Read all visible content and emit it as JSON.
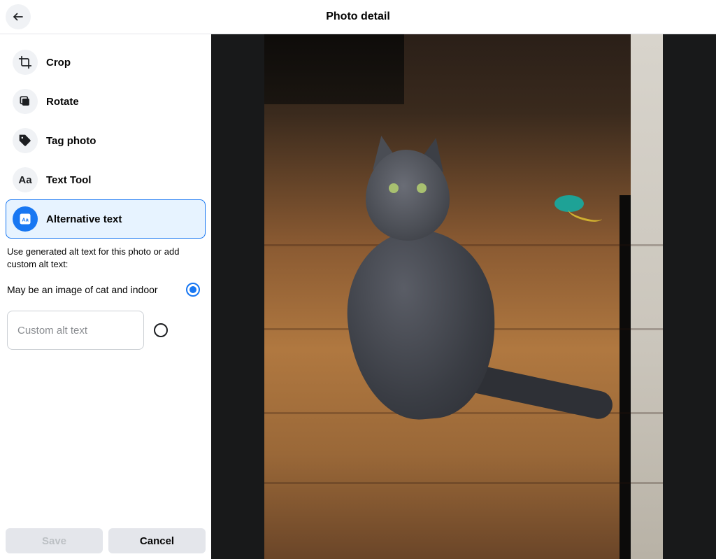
{
  "header": {
    "title": "Photo detail"
  },
  "sidebar": {
    "tools": {
      "crop": "Crop",
      "rotate": "Rotate",
      "tag_photo": "Tag photo",
      "text_tool": "Text Tool",
      "alt_text": "Alternative text"
    },
    "alt": {
      "instructions": "Use generated alt text for this photo or add custom alt text:",
      "generated_label": "May be an image of cat and indoor",
      "custom_placeholder": "Custom alt text",
      "custom_value": "",
      "selected_option": "generated"
    }
  },
  "footer": {
    "save_label": "Save",
    "cancel_label": "Cancel",
    "save_enabled": false
  },
  "colors": {
    "accent": "#1877f2",
    "selection_bg": "#e7f3ff",
    "icon_bg": "#f0f2f5",
    "button_bg": "#e4e6eb"
  }
}
